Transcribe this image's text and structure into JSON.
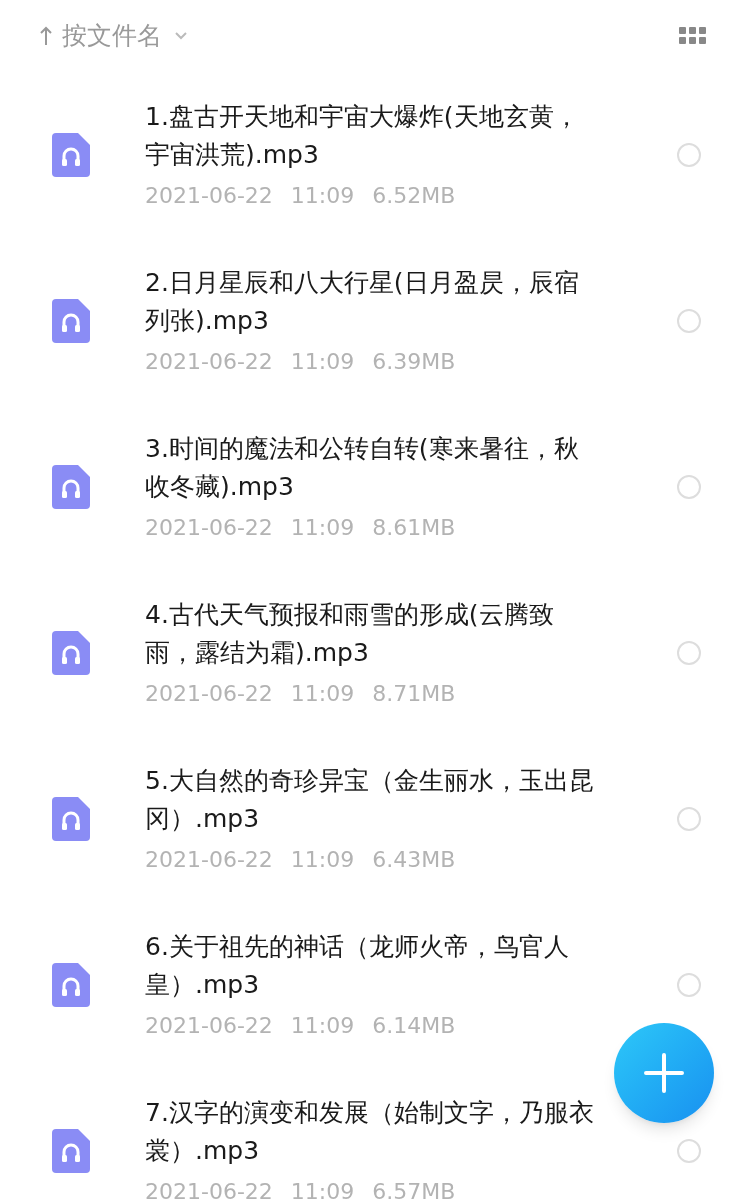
{
  "sort": {
    "label": "按文件名"
  },
  "files": [
    {
      "name": "1.盘古开天地和宇宙大爆炸(天地玄黄，宇宙洪荒).mp3",
      "date": "2021-06-22",
      "time": "11:09",
      "size": "6.52MB",
      "selected": false
    },
    {
      "name": "2.日月星辰和八大行星(日月盈昃，辰宿列张).mp3",
      "date": "2021-06-22",
      "time": "11:09",
      "size": "6.39MB",
      "selected": false
    },
    {
      "name": "3.时间的魔法和公转自转(寒来暑往，秋收冬藏).mp3",
      "date": "2021-06-22",
      "time": "11:09",
      "size": "8.61MB",
      "selected": false
    },
    {
      "name": "4.古代天气预报和雨雪的形成(云腾致雨，露结为霜).mp3",
      "date": "2021-06-22",
      "time": "11:09",
      "size": "8.71MB",
      "selected": false
    },
    {
      "name": "5.大自然的奇珍异宝（金生丽水，玉出昆冈）.mp3",
      "date": "2021-06-22",
      "time": "11:09",
      "size": "6.43MB",
      "selected": false
    },
    {
      "name": "6.关于祖先的神话（龙师火帝，鸟官人皇）.mp3",
      "date": "2021-06-22",
      "time": "11:09",
      "size": "6.14MB",
      "selected": false
    },
    {
      "name": "7.汉字的演变和发展（始制文字，乃服衣裳）.mp3",
      "date": "2021-06-22",
      "time": "11:09",
      "size": "6.57MB",
      "selected": false
    }
  ]
}
